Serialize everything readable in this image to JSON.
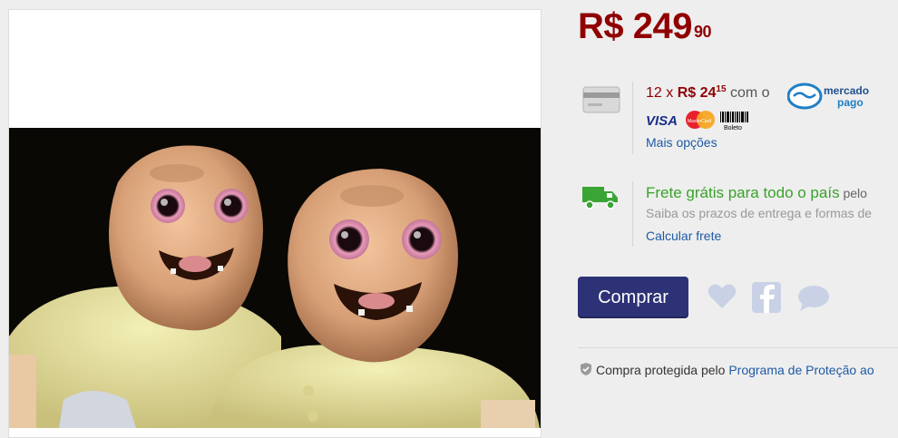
{
  "price": {
    "currency_whole": "R$ 249",
    "cents": "90"
  },
  "payment": {
    "installments_prefix": "12 x ",
    "installment_value": "R$ 24",
    "installment_cents": "15",
    "with_text": " com o",
    "mercado_pago_line1": "mercado",
    "mercado_pago_line2": "pago",
    "visa_label": "VISA",
    "mastercard_label": "MasterCard",
    "boleto_label": "Boleto",
    "more_options_link": "Mais opções"
  },
  "shipping": {
    "title": "Frete grátis para todo o país",
    "title_suffix": " pelo",
    "subtitle": "Saiba os prazos de entrega e formas de",
    "calc_link": "Calcular frete"
  },
  "actions": {
    "buy_label": "Comprar"
  },
  "protection": {
    "text": "Compra protegida pelo ",
    "link": "Programa de Proteção ao"
  },
  "colors": {
    "price": "#900000",
    "shipping": "#39a22b",
    "button": "#2d3277",
    "link": "#1f5aa6"
  }
}
